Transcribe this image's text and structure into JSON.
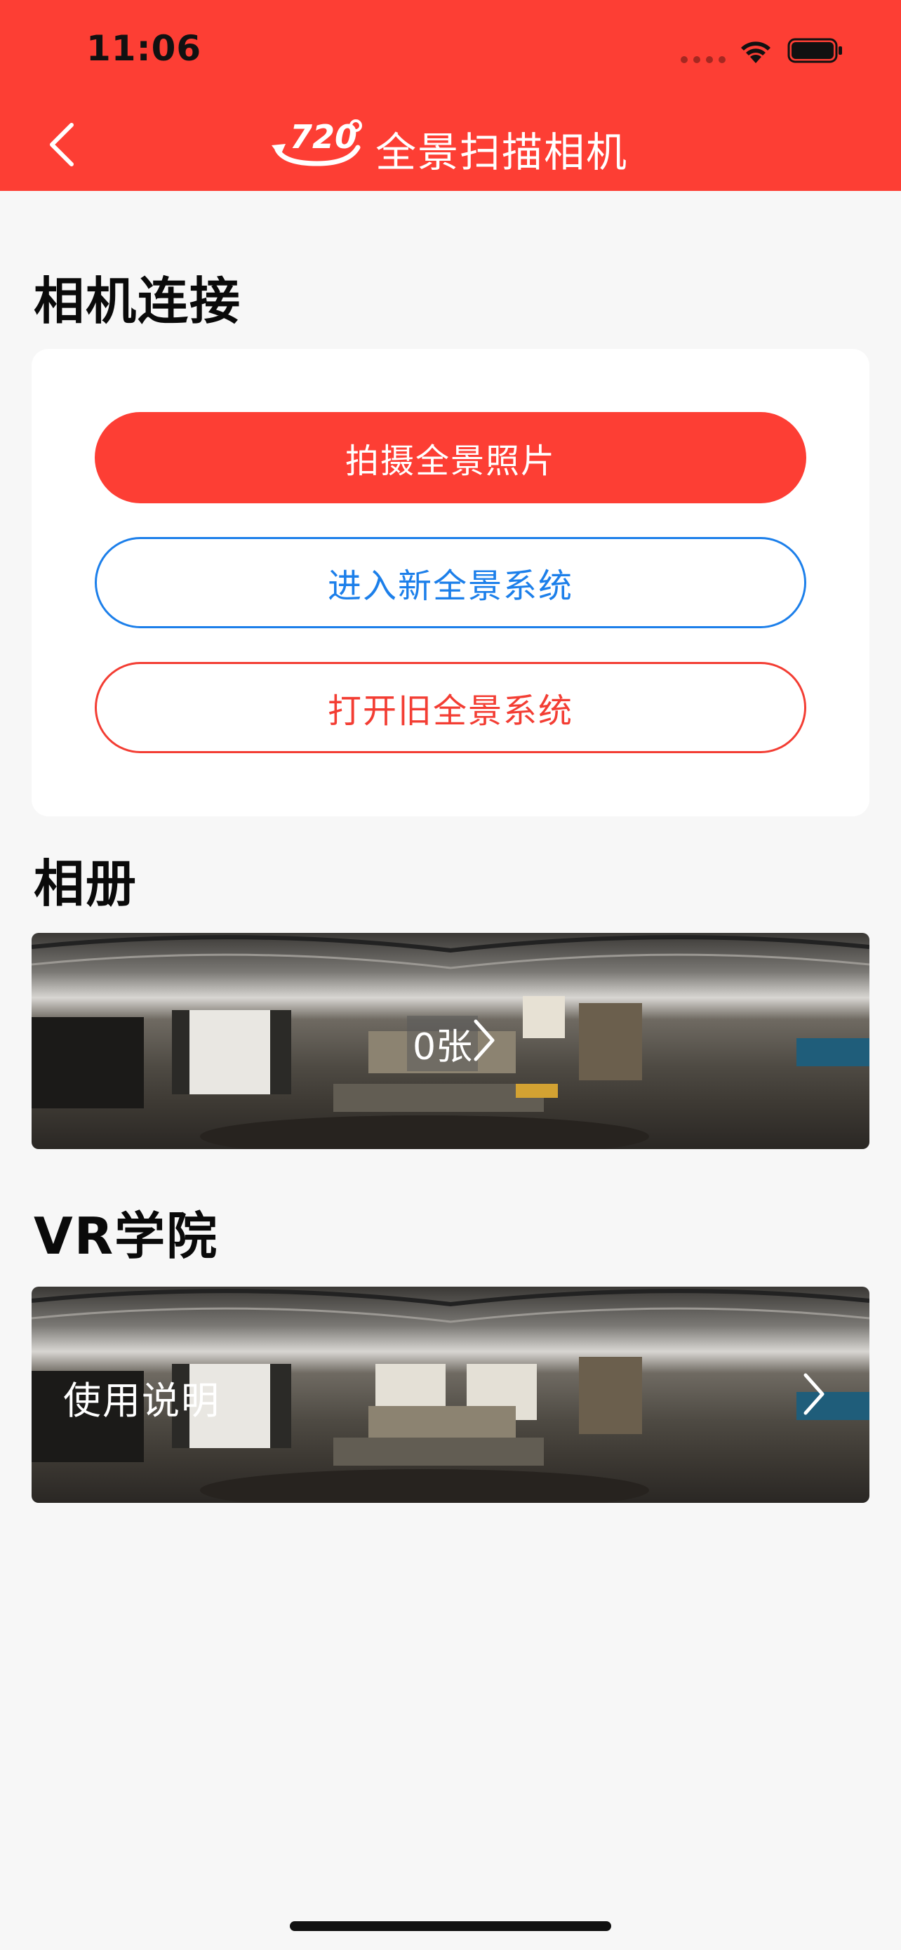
{
  "status_bar": {
    "time": "11:06",
    "wifi_icon": "wifi-icon",
    "battery_icon": "battery-icon"
  },
  "header": {
    "back_icon": "chevron-left-icon",
    "logo_text": "720°",
    "title": "全景扫描相机",
    "background_color": "#fd3e34"
  },
  "camera_section": {
    "title": "相机连接",
    "buttons": [
      {
        "label": "拍摄全景照片",
        "style": "primary",
        "color": "#fd3e34"
      },
      {
        "label": "进入新全景系统",
        "style": "outline",
        "color": "#1c7fea"
      },
      {
        "label": "打开旧全景系统",
        "style": "outline",
        "color": "#f33d33"
      }
    ]
  },
  "album_section": {
    "title": "相册",
    "count_label": "0张",
    "chevron_icon": "chevron-right-icon"
  },
  "vr_section": {
    "title": "VR学院",
    "item_label": "使用说明",
    "chevron_icon": "chevron-right-icon"
  }
}
